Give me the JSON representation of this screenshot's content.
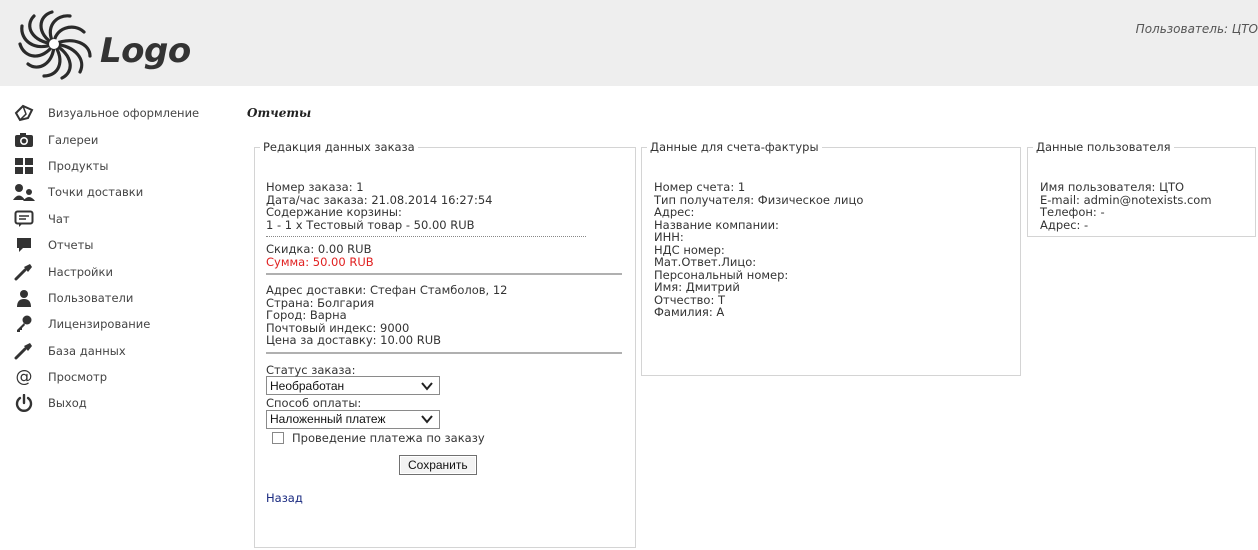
{
  "header": {
    "logo_text": "Logo",
    "user_info": "Пользователь: ЦТО"
  },
  "sidebar": {
    "items": [
      {
        "label": "Визуальное оформление",
        "icon": "palette-icon"
      },
      {
        "label": "Галереи",
        "icon": "camera-icon"
      },
      {
        "label": "Продукты",
        "icon": "products-icon"
      },
      {
        "label": "Точки доставки",
        "icon": "delivery-icon"
      },
      {
        "label": "Чат",
        "icon": "chat-icon"
      },
      {
        "label": "Отчеты",
        "icon": "reports-icon"
      },
      {
        "label": "Настройки",
        "icon": "wrench-icon"
      },
      {
        "label": "Пользователи",
        "icon": "user-icon"
      },
      {
        "label": "Лицензирование",
        "icon": "key-icon"
      },
      {
        "label": "База данных",
        "icon": "wrench-icon"
      },
      {
        "label": "Просмотр",
        "icon": "at-icon"
      },
      {
        "label": "Выход",
        "icon": "power-icon"
      }
    ]
  },
  "main": {
    "title": "Отчеты",
    "order": {
      "legend": "Редакция данных заказа",
      "number": "Номер заказа: 1",
      "datetime": "Дата/час заказа: 21.08.2014 16:27:54",
      "cart_label": "Содержание корзины:",
      "cart_item": "1 - 1 x Тестовый товар - 50.00 RUB",
      "discount": "Скидка: 0.00 RUB",
      "total": "Сумма: 50.00 RUB",
      "address": "Адрес доставки: Стефан Стамболов, 12",
      "country": "Страна: Болгария",
      "city": "Город: Варна",
      "zip": "Почтовый индекс: 9000",
      "delivery_price": "Цена за доставку: 10.00 RUB",
      "status_label": "Статус заказа:",
      "status_value": "Необработан",
      "payment_label": "Способ оплаты:",
      "payment_value": "Наложенный платеж",
      "payment_check_label": "Проведение платежа по заказу",
      "save_label": "Сохранить",
      "back_label": "Назад"
    },
    "invoice": {
      "legend": "Данные для счета-фактуры",
      "lines": [
        "Номер счета: 1",
        "Тип получателя: Физическое лицо",
        "Адрес:",
        "Название компании:",
        "ИНН:",
        "НДС номер:",
        "Мат.Ответ.Лицо:",
        "Персональный номер:",
        "Имя: Дмитрий",
        "Отчество: Т",
        "Фамилия: А"
      ]
    },
    "user": {
      "legend": "Данные пользователя",
      "lines": [
        "Имя пользователя: ЦТО",
        "E-mail: admin@notexists.com",
        "Телефон: -",
        "Адрес: -"
      ]
    }
  }
}
